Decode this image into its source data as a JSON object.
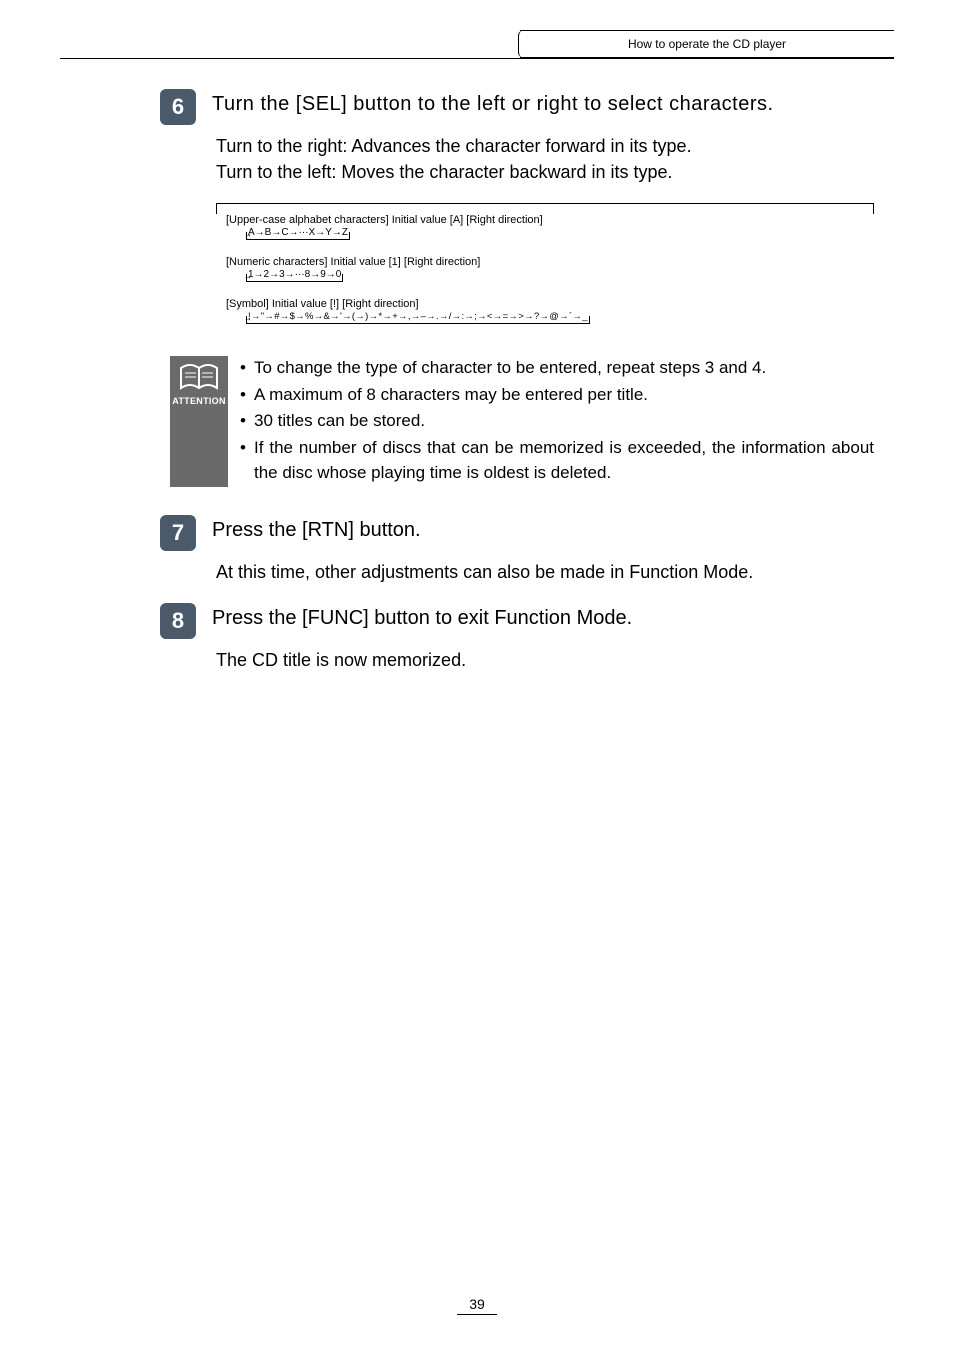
{
  "header": {
    "breadcrumb": "How to operate the CD player"
  },
  "step6": {
    "num": "6",
    "title": "Turn the [SEL] button to the left or right to select characters.",
    "body_l1": "Turn to the right:  Advances the character forward in its type.",
    "body_l2": "Turn to the left:    Moves the character backward in its type."
  },
  "charbox": {
    "upper_label": "[Upper-case alphabet characters] Initial value [A]     [Right direction]",
    "upper_seq": "A→B→C→···X→Y→Z",
    "numeric_label": "[Numeric characters] Initial value [1]     [Right direction]",
    "numeric_seq": "1→2→3→···8→9→0",
    "symbol_label": "[Symbol] Initial value [!]        [Right direction]",
    "symbol_seq": " !→\"→#→$→%→&→'→(→)→*→+→,→–→.→/→:→;→<→=→>→?→@→´→_"
  },
  "attention": {
    "label": "ATTENTION",
    "b1": "To change the type of character to be entered, repeat steps 3 and 4.",
    "b2": "A maximum of 8 characters may be entered per title.",
    "b3": "30 titles can be stored.",
    "b4": "If the number of discs that can be memorized is exceeded, the information about the disc whose playing time is oldest is deleted."
  },
  "step7": {
    "num": "7",
    "title": "Press the [RTN] button.",
    "body": "At this time, other adjustments can also be made in Function Mode."
  },
  "step8": {
    "num": "8",
    "title": "Press the [FUNC] button to exit Function Mode.",
    "body": "The CD title is now memorized."
  },
  "page_number": "39"
}
